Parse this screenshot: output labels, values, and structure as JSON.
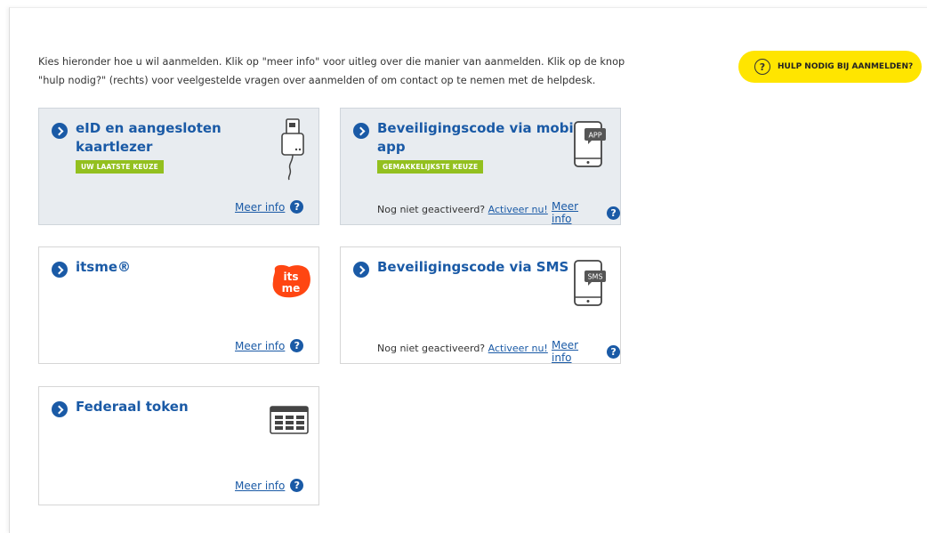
{
  "intro": {
    "line1": "Kies hieronder hoe u wil aanmelden. Klik op \"meer info\" voor uitleg over die manier van aanmelden. Klik op de knop",
    "line2": "\"hulp nodig?\" (rechts) voor veelgestelde vragen over aanmelden of om contact op te nemen met de helpdesk."
  },
  "help_button": {
    "icon": "?",
    "label": "HULP NODIG BIJ AANMELDEN?"
  },
  "colors": {
    "accent": "#1a5aa6",
    "badge": "#93c01f",
    "help": "#ffe500",
    "itsme": "#ff4612"
  },
  "cards": {
    "eid": {
      "title_line1": "eID en aangesloten",
      "title_line2": "kaartlezer",
      "badge": "UW LAATSTE KEUZE",
      "more_info": "Meer info",
      "icon": "card-reader-icon"
    },
    "app": {
      "title_line1": "Beveiligingscode via mobiele",
      "title_line2": "app",
      "badge": "GEMAKKELIJKSTE KEUZE",
      "not_activated": "Nog niet geactiveerd?",
      "activate": "Activeer nu!",
      "more_info": "Meer info",
      "icon_label": "APP"
    },
    "itsme": {
      "title": "itsme®",
      "logo_line1": "its",
      "logo_line2": "me",
      "more_info": "Meer info"
    },
    "sms": {
      "title": "Beveiligingscode via SMS",
      "not_activated": "Nog niet geactiveerd?",
      "activate": "Activeer nu!",
      "more_info": "Meer info",
      "icon_label": "SMS"
    },
    "token": {
      "title": "Federaal token",
      "more_info": "Meer info",
      "icon": "token-card-icon"
    }
  }
}
